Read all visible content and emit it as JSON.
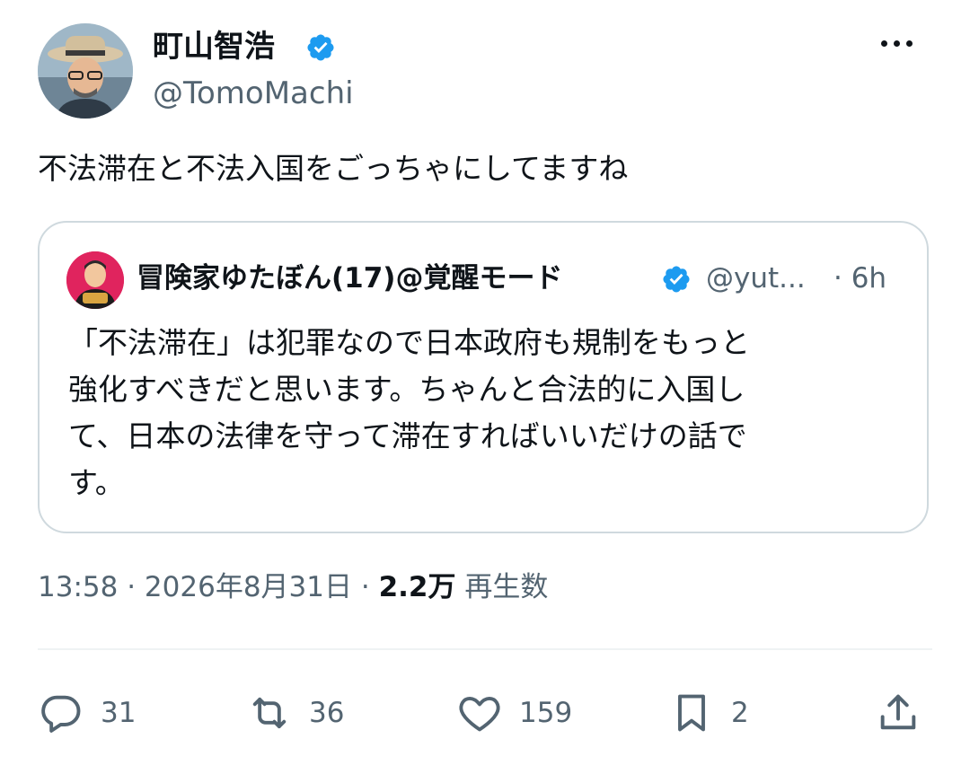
{
  "author": {
    "display_name": "町山智浩",
    "handle": "@TomoMachi",
    "verified": true
  },
  "tweet": {
    "text": "不法滞在と不法入国をごっちゃにしてますね"
  },
  "quote": {
    "display_name": "冒険家ゆたぼん(17)@覚醒モード",
    "handle": "@yut...",
    "time": "· 6h",
    "text_lines": [
      "「不法滞在」は犯罪なので日本政府も規制をもっと",
      "強化すべきだと思います。ちゃんと合法的に入国し",
      "て、日本の法律を守って滞在すればいいだけの話で",
      "す。"
    ]
  },
  "meta": {
    "time": "13:58",
    "separator": "·",
    "date": "2026年8月31日",
    "views_count": "2.2万",
    "views_label": "再生数"
  },
  "actions": {
    "replies": "31",
    "reposts": "36",
    "likes": "159",
    "bookmarks": "2"
  },
  "colors": {
    "verified_blue": "#1d9bf0",
    "text_primary": "#0f1419",
    "text_secondary": "#536471",
    "border": "#cfd9de"
  }
}
